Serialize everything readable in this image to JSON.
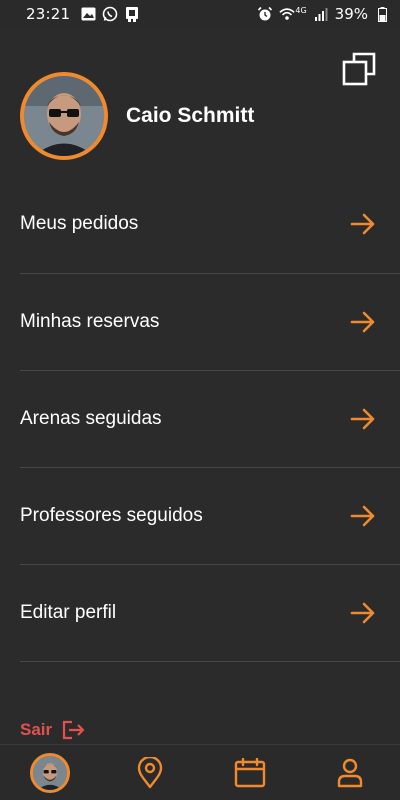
{
  "status_bar": {
    "time": "23:21",
    "network": "4G",
    "battery": "39%"
  },
  "profile": {
    "name": "Caio Schmitt"
  },
  "menu": {
    "items": [
      {
        "label": "Meus pedidos"
      },
      {
        "label": "Minhas reservas"
      },
      {
        "label": "Arenas seguidas"
      },
      {
        "label": "Professores seguidos"
      },
      {
        "label": "Editar perfil"
      }
    ]
  },
  "logout": {
    "label": "Sair"
  },
  "bottom_nav": {
    "items": [
      "avatar",
      "location-pin-icon",
      "calendar-icon",
      "user-icon"
    ]
  },
  "colors": {
    "accent": "#ef8a2f",
    "logout": "#e0524f",
    "background": "#2b2b2b"
  }
}
